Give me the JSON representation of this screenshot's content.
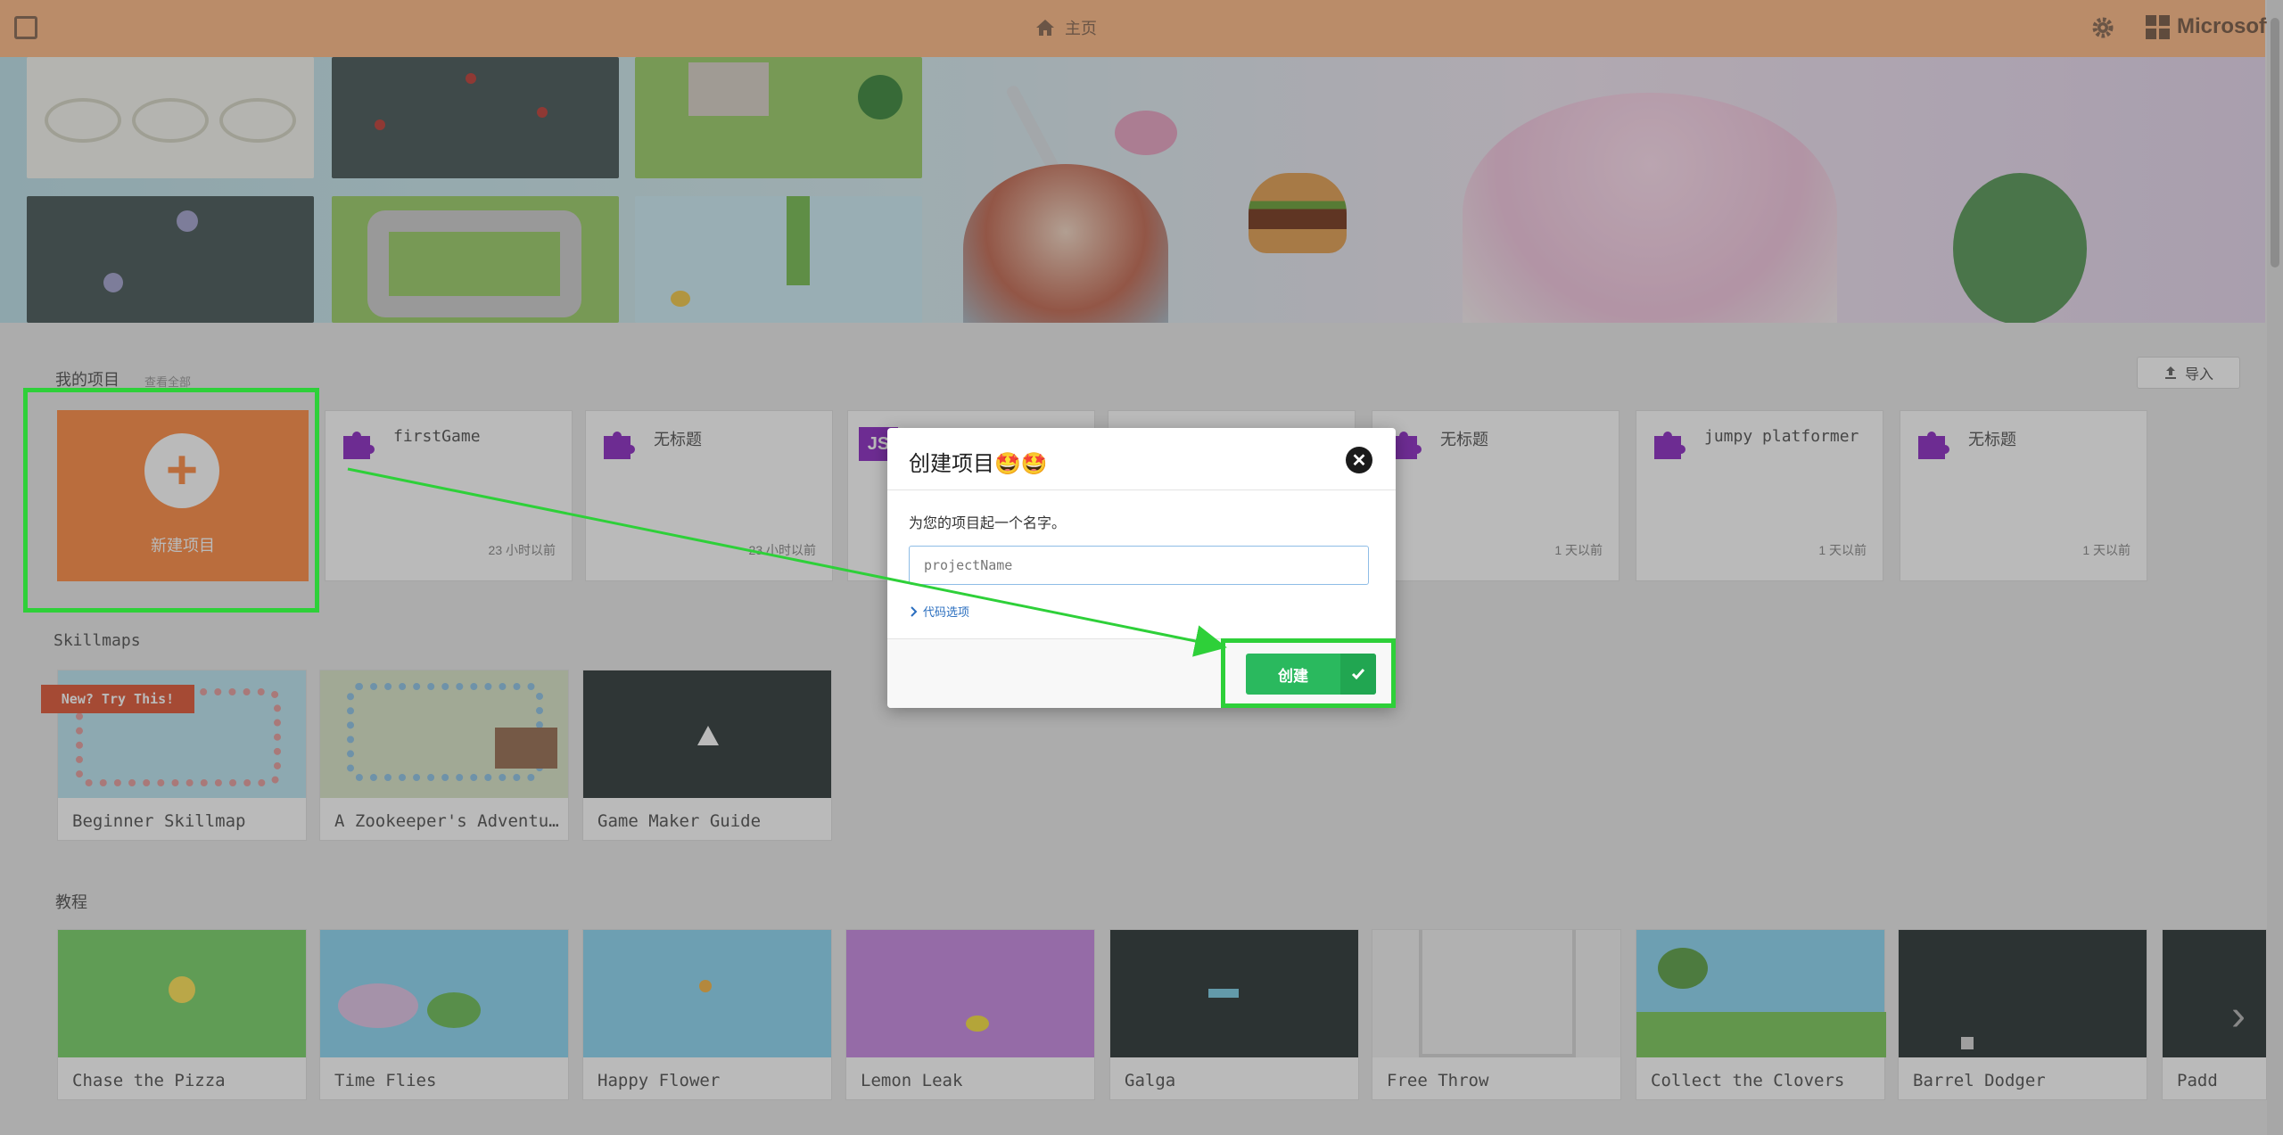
{
  "header": {
    "home_label": "主页",
    "brand": "Microsoft"
  },
  "my_projects": {
    "title": "我的项目",
    "view_all": "查看全部",
    "import_label": "导入",
    "new_project_label": "新建项目",
    "cards": [
      {
        "name": "firstGame",
        "time": "23 小时以前"
      },
      {
        "name": "无标题",
        "time": "23 小时以前"
      },
      {
        "name": "",
        "time": ""
      },
      {
        "name": "",
        "time": ""
      },
      {
        "name": "无标题",
        "time": "1 天以前"
      },
      {
        "name": "jumpy platformer",
        "time": "1 天以前"
      },
      {
        "name": "无标题",
        "time": "1 天以前"
      }
    ]
  },
  "skillmaps": {
    "title": "Skillmaps",
    "badge": "New? Try This!",
    "cards": [
      "Beginner Skillmap",
      "A Zookeeper's Adventu…",
      "Game Maker Guide"
    ]
  },
  "tutorials": {
    "title": "教程",
    "cards": [
      "Chase the Pizza",
      "Time Flies",
      "Happy Flower",
      "Lemon Leak",
      "Galga",
      "Free Throw",
      "Collect the Clovers",
      "Barrel Dodger",
      "Padd"
    ]
  },
  "modal": {
    "title": "创建项目🤩🤩",
    "prompt": "为您的项目起一个名字。",
    "input_placeholder": "projectName",
    "input_value": "",
    "code_options": "代码选项",
    "create_label": "创建"
  },
  "colors": {
    "header": "#ffbb88",
    "new_project": "#ff8e47",
    "create_button": "#2ab95e",
    "annotation": "#2ed039",
    "overlay": "rgba(40,40,40,0.32)"
  },
  "icons": [
    "home-icon",
    "gear-icon",
    "microsoft-logo-icon",
    "plus-icon",
    "puzzle-icon",
    "upload-icon",
    "close-icon",
    "chevron-right-icon",
    "check-icon"
  ]
}
